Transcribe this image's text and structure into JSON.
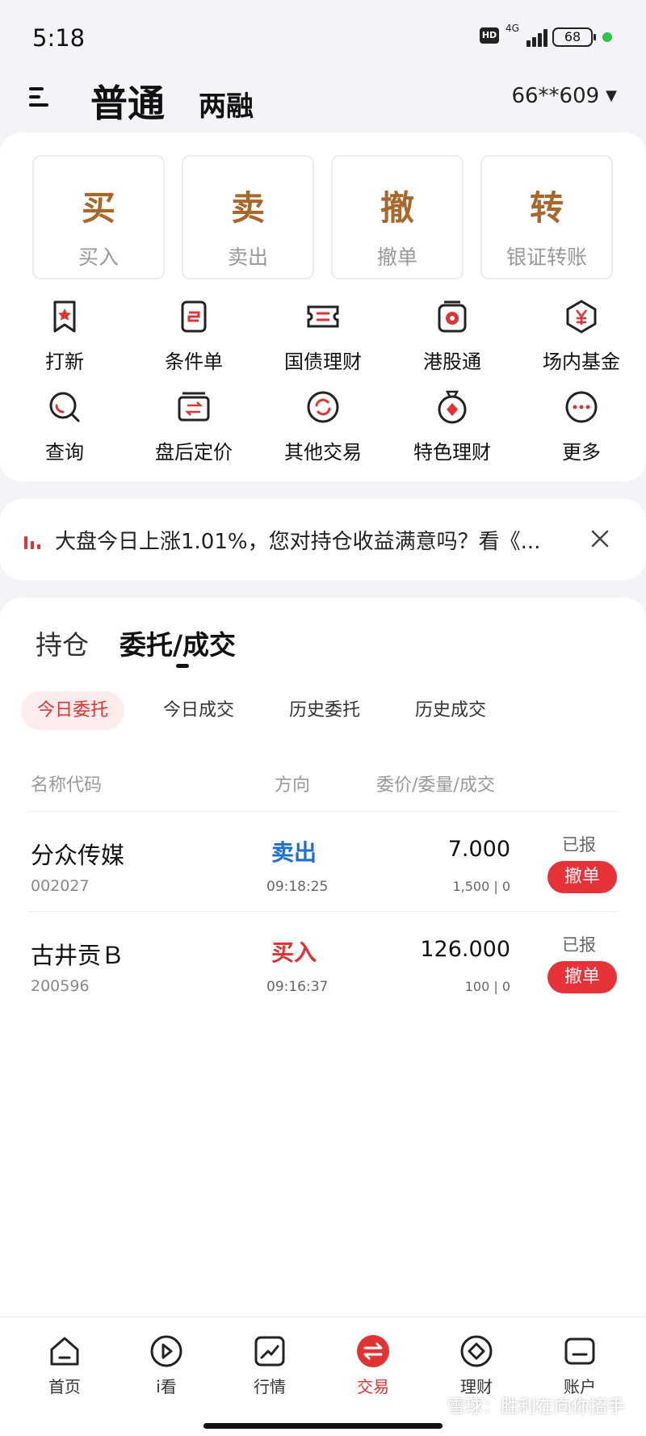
{
  "status_bar": {
    "time": "5:18",
    "hd": "HD",
    "network": "4G",
    "battery": "68"
  },
  "header": {
    "tab_main": "普通",
    "tab_sub": "两融",
    "account": "66**609"
  },
  "quick_actions": [
    {
      "char": "买",
      "label": "买入"
    },
    {
      "char": "卖",
      "label": "卖出"
    },
    {
      "char": "撤",
      "label": "撤单"
    },
    {
      "char": "转",
      "label": "银证转账"
    }
  ],
  "grid": [
    {
      "label": "打新",
      "icon": "ipo-bookmark-icon"
    },
    {
      "label": "条件单",
      "icon": "condition-order-icon"
    },
    {
      "label": "国债理财",
      "icon": "bond-ticket-icon"
    },
    {
      "label": "港股通",
      "icon": "hk-connect-icon"
    },
    {
      "label": "场内基金",
      "icon": "fund-yen-icon"
    },
    {
      "label": "查询",
      "icon": "search-icon"
    },
    {
      "label": "盘后定价",
      "icon": "after-hours-pricing-icon"
    },
    {
      "label": "其他交易",
      "icon": "other-trade-icon"
    },
    {
      "label": "特色理财",
      "icon": "featured-finance-icon"
    },
    {
      "label": "更多",
      "icon": "more-icon"
    }
  ],
  "notice": {
    "text": "大盘今日上涨1.01%，您对持仓收益满意吗？看《..."
  },
  "orders_section": {
    "segments": [
      "持仓",
      "委托/成交"
    ],
    "chips": [
      "今日委托",
      "今日成交",
      "历史委托",
      "历史成交"
    ],
    "columns": {
      "name": "名称代码",
      "direction": "方向",
      "price": "委价/委量/成交"
    },
    "rows": [
      {
        "name": "分众传媒",
        "code": "002027",
        "direction": "卖出",
        "dir_color": "#1f6fd1",
        "time": "09:18:25",
        "price": "7.000",
        "qty": "1,500 | 0",
        "status": "已报",
        "cancel": "撤单"
      },
      {
        "name": "古井贡Ｂ",
        "code": "200596",
        "direction": "买入",
        "dir_color": "#e03434",
        "time": "09:16:37",
        "price": "126.000",
        "qty": "100 | 0",
        "status": "已报",
        "cancel": "撤单"
      }
    ]
  },
  "bottom_nav": [
    {
      "label": "首页",
      "icon": "home-icon"
    },
    {
      "label": "i看",
      "icon": "play-icon"
    },
    {
      "label": "行情",
      "icon": "market-chart-icon"
    },
    {
      "label": "交易",
      "icon": "trade-exchange-icon"
    },
    {
      "label": "理财",
      "icon": "finance-diamond-icon"
    },
    {
      "label": "账户",
      "icon": "account-icon"
    }
  ],
  "watermark": "雪球：胜利在向你招手",
  "colors": {
    "accent": "#e03434",
    "gold": "#a8682c",
    "sell_blue": "#1f6fd1"
  }
}
